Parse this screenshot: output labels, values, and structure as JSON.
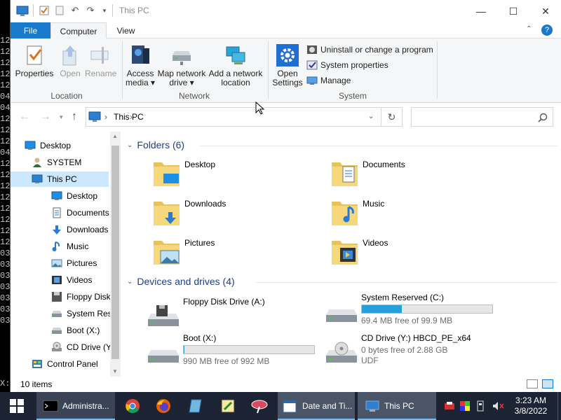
{
  "console": {
    "lines": [
      "12",
      "12",
      "12",
      "12",
      "12",
      "04",
      "04",
      "12",
      "12",
      "12",
      "04",
      "12",
      "12",
      "12",
      "12",
      "12",
      "12",
      "12",
      "12",
      "03",
      "03",
      "03",
      "03",
      "03",
      "03",
      "03"
    ],
    "prompt": "X:"
  },
  "window": {
    "title": "This PC",
    "minimize": "—",
    "maximize": "☐",
    "close": "✕"
  },
  "ribbon": {
    "tabs": {
      "file": "File",
      "computer": "Computer",
      "view": "View"
    },
    "location": {
      "label": "Location",
      "properties": "Properties",
      "open": "Open",
      "rename": "Rename"
    },
    "network": {
      "label": "Network",
      "access_media_1": "Access",
      "access_media_2": "media ▾",
      "map_drive_1": "Map network",
      "map_drive_2": "drive ▾",
      "add_location_1": "Add a network",
      "add_location_2": "location"
    },
    "system": {
      "label": "System",
      "open_settings_1": "Open",
      "open_settings_2": "Settings",
      "uninstall": "Uninstall or change a program",
      "system_properties": "System properties",
      "manage": "Manage"
    }
  },
  "address": {
    "path": "This PC",
    "separator": "›"
  },
  "nav_pane": {
    "items": [
      {
        "label": "Desktop",
        "icon": "desktop-icon"
      },
      {
        "label": "SYSTEM",
        "icon": "user-icon"
      },
      {
        "label": "This PC",
        "icon": "computer-icon"
      },
      {
        "label": "Desktop",
        "icon": "desktop-icon"
      },
      {
        "label": "Documents",
        "icon": "documents-icon"
      },
      {
        "label": "Downloads",
        "icon": "downloads-icon"
      },
      {
        "label": "Music",
        "icon": "music-icon"
      },
      {
        "label": "Pictures",
        "icon": "pictures-icon"
      },
      {
        "label": "Videos",
        "icon": "videos-icon"
      },
      {
        "label": "Floppy Disk Dri",
        "icon": "floppy-icon"
      },
      {
        "label": "System Reserve",
        "icon": "drive-icon"
      },
      {
        "label": "Boot (X:)",
        "icon": "drive-icon"
      },
      {
        "label": "CD Drive (Y:) H",
        "icon": "cd-icon"
      },
      {
        "label": "Control Panel",
        "icon": "control-panel-icon"
      }
    ]
  },
  "content": {
    "folders_header": "Folders (6)",
    "folders": [
      {
        "label": "Desktop"
      },
      {
        "label": "Documents"
      },
      {
        "label": "Downloads"
      },
      {
        "label": "Music"
      },
      {
        "label": "Pictures"
      },
      {
        "label": "Videos"
      }
    ],
    "devices_header": "Devices and drives (4)",
    "drives": [
      {
        "label": "Floppy Disk Drive (A:)",
        "sub": "",
        "sub2": "",
        "fill": null
      },
      {
        "label": "System Reserved (C:)",
        "sub": "69.4 MB free of 99.9 MB",
        "sub2": "",
        "fill": 0.305
      },
      {
        "label": "Boot (X:)",
        "sub": "990 MB free of 992 MB",
        "sub2": "",
        "fill": 0.002
      },
      {
        "label": "CD Drive (Y:) HBCD_PE_x64",
        "sub": "0 bytes free of 2.88 GB",
        "sub2": "UDF",
        "fill": null
      }
    ]
  },
  "status": {
    "items": "10 items"
  },
  "taskbar": {
    "apps": {
      "admin": "Administra...",
      "datetime": "Date and Ti...",
      "thispc": "This PC"
    },
    "clock_time": "3:23 AM",
    "clock_date": "3/8/2022"
  }
}
